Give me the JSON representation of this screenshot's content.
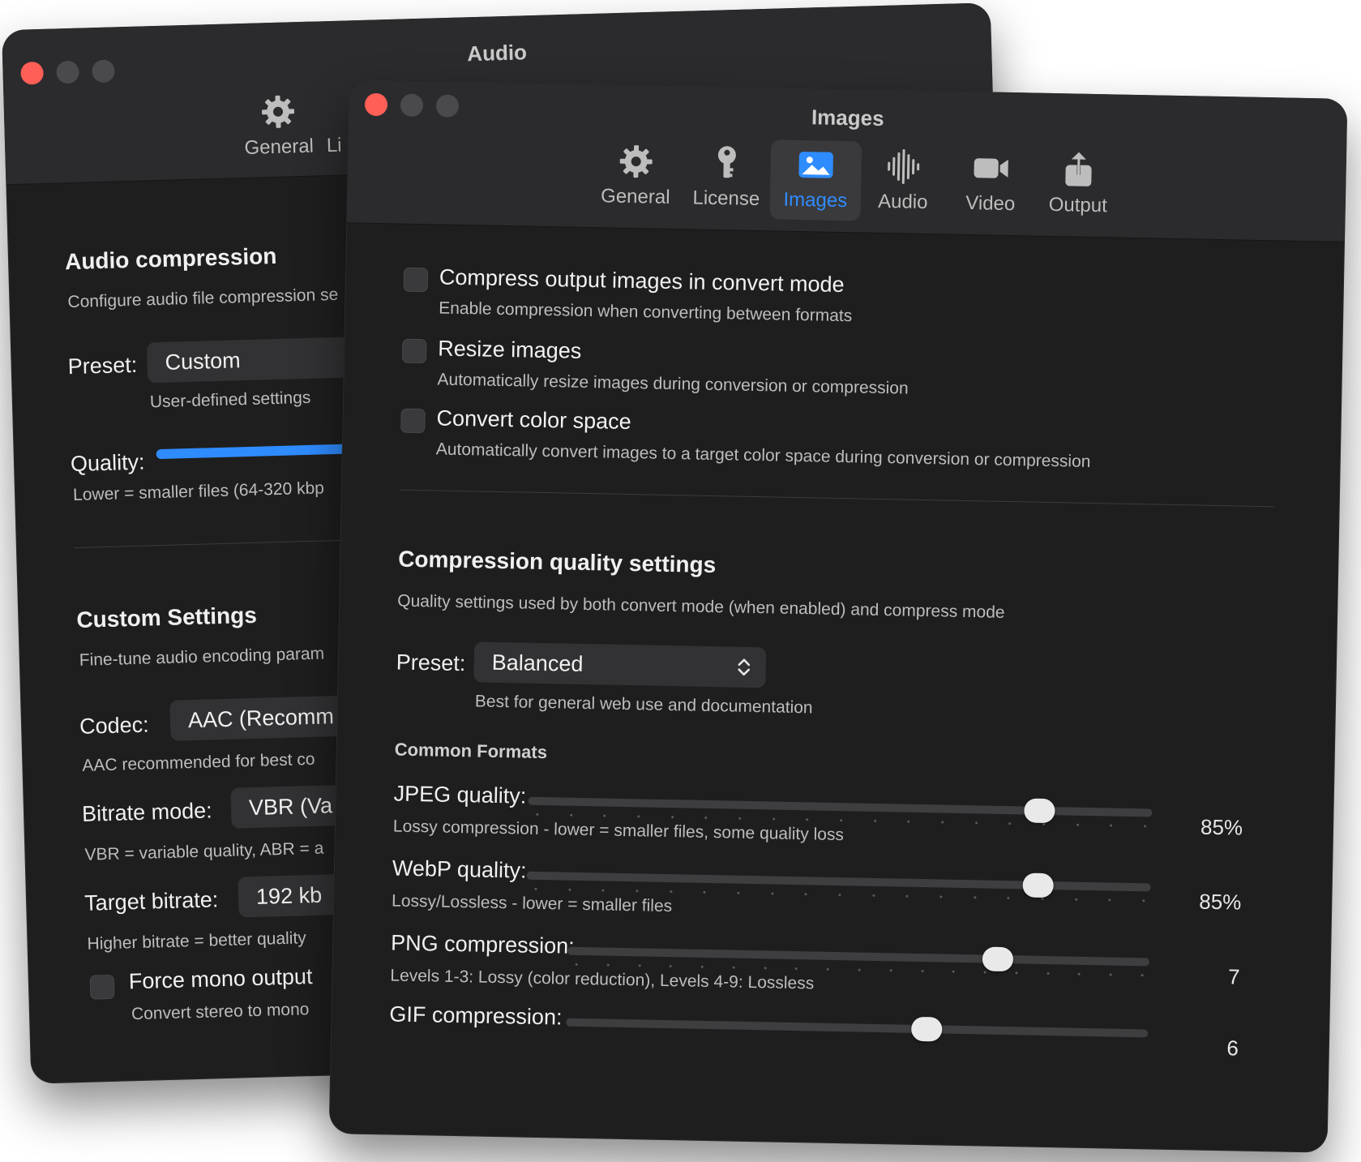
{
  "audio_window": {
    "title": "Audio",
    "tabs": [
      {
        "label": "General",
        "icon": "gear-icon"
      },
      {
        "label": "Li",
        "icon": "key-icon"
      }
    ],
    "section1": {
      "heading": "Audio compression",
      "description": "Configure audio file compression se",
      "preset_label": "Preset:",
      "preset_value": "Custom",
      "preset_hint": "User-defined settings",
      "quality_label": "Quality:",
      "quality_hint": "Lower = smaller files (64-320 kbp"
    },
    "section2": {
      "heading": "Custom Settings",
      "description": "Fine-tune audio encoding param",
      "codec_label": "Codec:",
      "codec_value": "AAC (Recomm",
      "codec_hint": "AAC recommended for best co",
      "bitrate_mode_label": "Bitrate mode:",
      "bitrate_mode_value": "VBR (Va",
      "bitrate_mode_hint": "VBR = variable quality, ABR = a",
      "target_bitrate_label": "Target bitrate:",
      "target_bitrate_value": "192 kb",
      "target_bitrate_hint": "Higher bitrate = better quality",
      "mono_title": "Force mono output",
      "mono_hint": "Convert stereo to mono"
    }
  },
  "images_window": {
    "title": "Images",
    "tabs": [
      {
        "label": "General",
        "icon": "gear-icon"
      },
      {
        "label": "License",
        "icon": "key-icon"
      },
      {
        "label": "Images",
        "icon": "photo-icon",
        "active": true
      },
      {
        "label": "Audio",
        "icon": "waveform-icon"
      },
      {
        "label": "Video",
        "icon": "video-camera-icon"
      },
      {
        "label": "Output",
        "icon": "share-icon"
      }
    ],
    "options": [
      {
        "title": "Compress output images in convert mode",
        "hint": "Enable compression when converting between formats"
      },
      {
        "title": "Resize images",
        "hint": "Automatically resize images during conversion or compression"
      },
      {
        "title": "Convert color space",
        "hint": "Automatically convert images to a target color space during conversion or compression"
      }
    ],
    "quality": {
      "heading": "Compression quality settings",
      "description": "Quality settings used by both convert mode (when enabled) and compress mode",
      "preset_label": "Preset:",
      "preset_value": "Balanced",
      "preset_hint": "Best for general web use and documentation",
      "common_formats": "Common Formats",
      "sliders": [
        {
          "label": "JPEG quality:",
          "hint": "Lossy compression - lower = smaller files, some quality loss",
          "value_text": "85%",
          "fraction": 0.82
        },
        {
          "label": "WebP quality:",
          "hint": "Lossy/Lossless - lower = smaller files",
          "value_text": "85%",
          "fraction": 0.82
        },
        {
          "label": "PNG compression:",
          "hint": "Levels 1-3: Lossy (color reduction), Levels 4-9: Lossless",
          "value_text": "7",
          "fraction": 0.74
        },
        {
          "label": "GIF compression:",
          "hint": "",
          "value_text": "6",
          "fraction": 0.62
        }
      ]
    }
  },
  "colors": {
    "accent": "#2f8cff",
    "window_bg": "#1e1e1e",
    "toolbar_bg": "#2b2b2d",
    "close_button": "#ff5f57"
  }
}
